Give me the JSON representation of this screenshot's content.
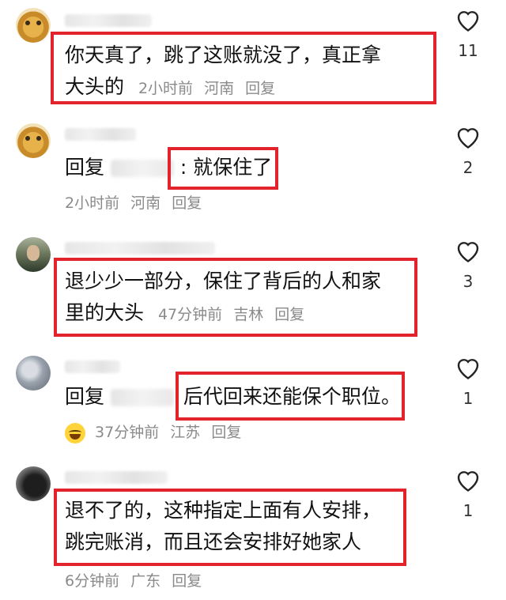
{
  "comments": [
    {
      "text_line1": "你天真了，跳了这账就没了，真正拿",
      "text_line2": "大头的",
      "time": "2小时前",
      "location": "河南",
      "reply": "回复",
      "likes": "11"
    },
    {
      "reply_prefix": "回复",
      "text": ": 就保住了",
      "time": "2小时前",
      "location": "河南",
      "reply": "回复",
      "likes": "2"
    },
    {
      "text_line1": "退少少一部分，保住了背后的人和家",
      "text_line2": "里的大头",
      "time": "47分钟前",
      "location": "吉林",
      "reply": "回复",
      "likes": "3"
    },
    {
      "reply_prefix": "回复",
      "text": "后代回来还能保个职位",
      "text_suffix": "。",
      "time": "37分钟前",
      "location": "江苏",
      "reply": "回复",
      "likes": "1"
    },
    {
      "text_line1": "退不了的，这种指定上面有人安排，",
      "text_line2": "跳完账消，而且还会安排好她家人",
      "time": "6分钟前",
      "location": "广东",
      "reply": "回复",
      "likes": "1"
    }
  ],
  "icons": {
    "like": "heart-outline-icon",
    "emoji": "laughing-tears-emoji-icon"
  },
  "colors": {
    "highlight_box": "#e2232b",
    "meta_text": "#8a8a8a"
  }
}
